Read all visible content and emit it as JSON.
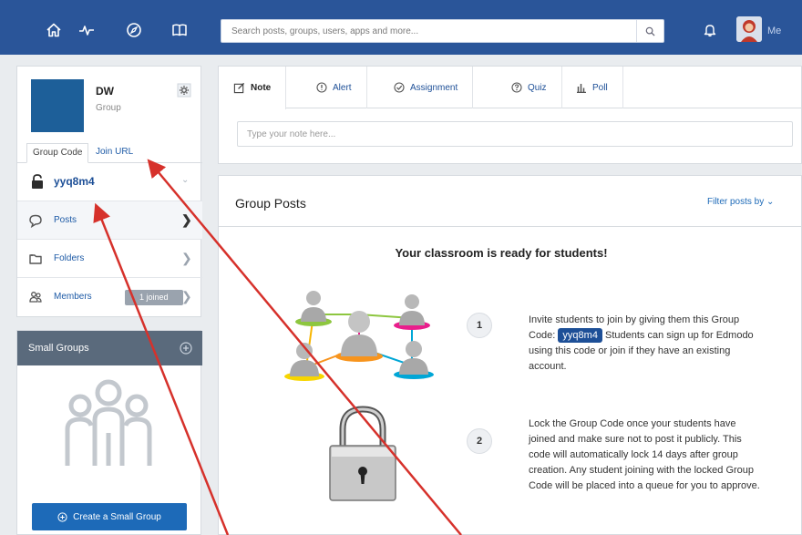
{
  "topbar": {
    "search_placeholder": "Search posts, groups, users, apps and more...",
    "profile_label": "Me",
    "icons": [
      "home-icon",
      "activity-icon",
      "compass-icon",
      "book-icon",
      "search-icon",
      "bell-icon"
    ],
    "bar_color": "#2a5599"
  },
  "group": {
    "name": "DW",
    "type": "Group",
    "code_tab_label": "Group Code",
    "join_url_tab_label": "Join URL",
    "code": "yyq8m4",
    "menu": [
      {
        "label": "Posts"
      },
      {
        "label": "Folders"
      },
      {
        "label": "Members",
        "badge": "1 joined"
      }
    ]
  },
  "small_groups": {
    "title": "Small Groups",
    "create_label": "Create a Small Group"
  },
  "composer": {
    "tabs": [
      {
        "label": "Note"
      },
      {
        "label": "Alert"
      },
      {
        "label": "Assignment"
      },
      {
        "label": "Quiz"
      },
      {
        "label": "Poll"
      }
    ],
    "note_placeholder": "Type your note here..."
  },
  "posts": {
    "title": "Group Posts",
    "filter_label": "Filter posts by",
    "ready_title": "Your classroom is ready for students!",
    "step1_number": "1",
    "step1_before": "Invite students to join by giving them this Group Code:",
    "step1_code": "yyq8m4",
    "step1_after": "Students can sign up for Edmodo using this code or join if they have an existing account.",
    "step2_number": "2",
    "step2_text": "Lock the Group Code once your students have joined and make sure not to post it publicly. This code will automatically lock 14 days after group creation. Any student joining with the locked Group Code will be placed into a queue for you to approve."
  },
  "colors": {
    "brand_blue": "#1d4f97",
    "link_blue": "#1d6ab8",
    "annotation_red": "#d6312b"
  }
}
